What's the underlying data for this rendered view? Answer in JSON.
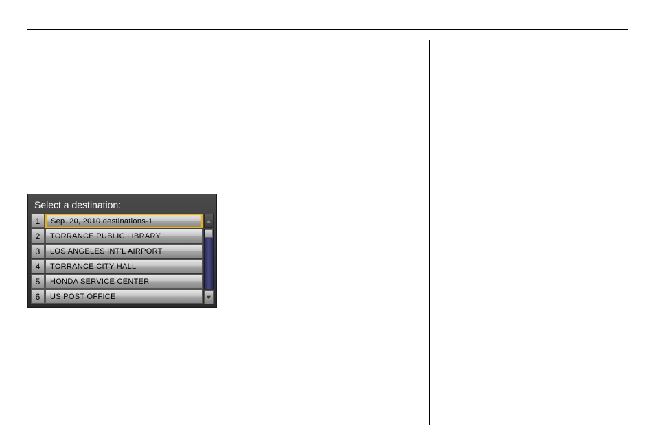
{
  "nav_panel": {
    "title": "Select a destination:",
    "items": [
      {
        "number": "1",
        "label": "Sep. 20, 2010 destinations-1",
        "selected": true
      },
      {
        "number": "2",
        "label": "TORRANCE PUBLIC LIBRARY",
        "selected": false
      },
      {
        "number": "3",
        "label": "LOS ANGELES INT'L AIRPORT",
        "selected": false
      },
      {
        "number": "4",
        "label": "TORRANCE CITY HALL",
        "selected": false
      },
      {
        "number": "5",
        "label": "HONDA SERVICE CENTER",
        "selected": false
      },
      {
        "number": "6",
        "label": "US POST OFFICE",
        "selected": false
      }
    ]
  }
}
